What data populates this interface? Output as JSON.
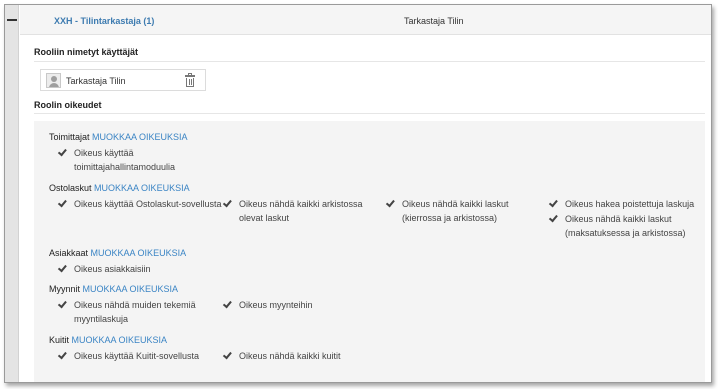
{
  "header": {
    "role_link": "XXH - Tilintarkastaja (1)",
    "user_name": "Tarkastaja Tilin"
  },
  "named_users": {
    "title": "Rooliin nimetyt käyttäjät",
    "users": [
      {
        "name": "Tarkastaja Tilin"
      }
    ]
  },
  "rights": {
    "title": "Roolin oikeudet",
    "edit_label": "MUOKKAA OIKEUKSIA",
    "groups": [
      {
        "name": "Toimittajat",
        "permissions": [
          {
            "text": "Oikeus käyttää toimittajahallintamoduulia"
          }
        ]
      },
      {
        "name": "Ostolaskut",
        "permissions": [
          {
            "text": "Oikeus käyttää Ostolaskut-sovellusta"
          },
          {
            "text": "Oikeus nähdä kaikki arkistossa olevat laskut"
          },
          {
            "text": "Oikeus nähdä kaikki laskut (kierrossa ja arkistossa)"
          },
          {
            "text": "Oikeus hakea poistettuja laskuja"
          },
          {
            "text": "Oikeus nähdä kaikki laskut (maksatuksessa ja arkistossa)"
          }
        ]
      },
      {
        "name": "Asiakkaat",
        "permissions": [
          {
            "text": "Oikeus asiakkaisiin"
          }
        ]
      },
      {
        "name": "Myynnit",
        "permissions": [
          {
            "text": "Oikeus nähdä muiden tekemiä myyntilaskuja"
          },
          {
            "text": "Oikeus myynteihin"
          }
        ]
      },
      {
        "name": "Kuitit",
        "permissions": [
          {
            "text": "Oikeus käyttää Kuitit-sovellusta"
          },
          {
            "text": "Oikeus nähdä kaikki kuitit"
          }
        ]
      }
    ]
  }
}
